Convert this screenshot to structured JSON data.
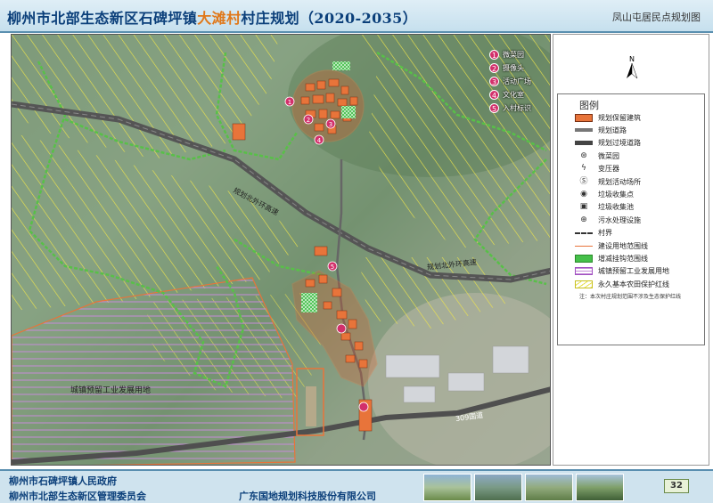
{
  "header": {
    "title_part1": "柳州市北部生态新区石碑坪镇",
    "title_highlight": "大滩村",
    "title_part2": "村庄规划（2020-2035）",
    "subtitle": "凤山屯居民点规划图"
  },
  "map": {
    "road_label_1": "规划北外环高速",
    "road_label_2": "规划北外环高速",
    "industrial_label": "城镇预留工业发展用地",
    "national_road_label": "309国道",
    "marker_labels": [
      "1",
      "2",
      "3",
      "4",
      "5"
    ]
  },
  "markers": [
    {
      "num": "1",
      "label": "微菜园"
    },
    {
      "num": "2",
      "label": "摄像头"
    },
    {
      "num": "3",
      "label": "活动广场"
    },
    {
      "num": "4",
      "label": "文化室"
    },
    {
      "num": "5",
      "label": "入村标识"
    }
  ],
  "legend": {
    "title": "图例",
    "items": [
      {
        "label": "规划保留建筑",
        "icon": "orange-fill"
      },
      {
        "label": "规划道路",
        "icon": "gray-road"
      },
      {
        "label": "规划过境道路",
        "icon": "dark-road"
      },
      {
        "label": "微菜园",
        "icon": "vegetable-garden-icon"
      },
      {
        "label": "变压器",
        "icon": "transformer-icon"
      },
      {
        "label": "规划活动场所",
        "icon": "activity-icon"
      },
      {
        "label": "垃圾收集点",
        "icon": "garbage-point-icon"
      },
      {
        "label": "垃圾收集池",
        "icon": "garbage-pool-icon"
      },
      {
        "label": "污水处理设施",
        "icon": "sewage-icon"
      },
      {
        "label": "村界",
        "icon": "dashed-line"
      },
      {
        "label": "建设用地范围线",
        "icon": "red-line"
      },
      {
        "label": "增减挂钩范围线",
        "icon": "green-hatch"
      },
      {
        "label": "城镇预留工业发展用地",
        "icon": "purple-hatch"
      },
      {
        "label": "永久基本农田保护红线",
        "icon": "yellow-hatch"
      }
    ],
    "note": "注：本次村庄规划范围不涉及生态保护红线"
  },
  "footer": {
    "gov1": "柳州市石碑坪镇人民政府",
    "gov2": "柳州市北部生态新区管理委员会",
    "company": "广东国地规划科技股份有限公司",
    "page": "32"
  },
  "colors": {
    "header_blue": "#0b3f7a",
    "highlight_orange": "#e0781a",
    "building_orange": "#e8743a",
    "marker_pink": "#d2306b",
    "hatch_yellow": "#e8e04a",
    "hatch_purple": "#c58bd8",
    "road_gray": "#5b5b5b"
  }
}
